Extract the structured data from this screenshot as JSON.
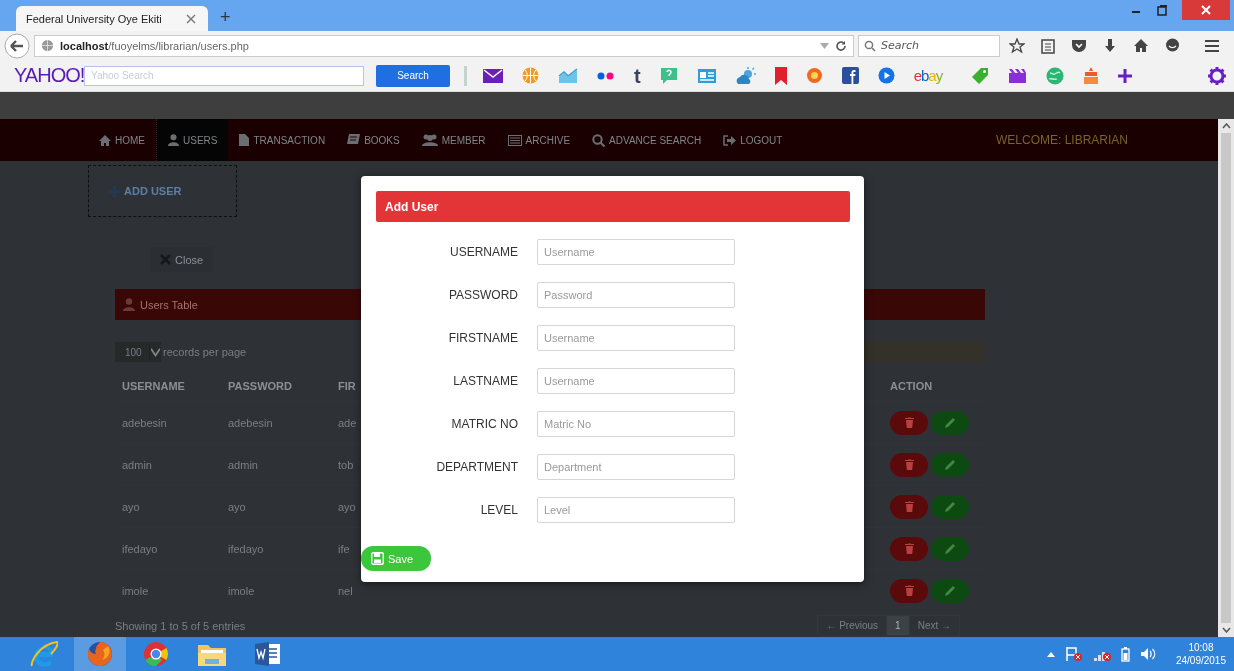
{
  "browser": {
    "tab": {
      "title": "Federal University Oye Ekiti",
      "selected": true
    },
    "new_tab": "+",
    "url": {
      "host": "localhost",
      "path": "/fuoyelms/librarian/users.php"
    },
    "search": {
      "placeholder": "Search"
    }
  },
  "yahoo_toolbar": {
    "logo": "YAHOO!",
    "search": {
      "placeholder": "Yahoo Search"
    },
    "search_button": "Search",
    "tumblr": "t",
    "ebay": "ebay"
  },
  "nav": {
    "items": [
      {
        "kind": "home",
        "label": "HOME",
        "selected": false
      },
      {
        "kind": "user",
        "label": "USERS",
        "selected": true
      },
      {
        "kind": "file",
        "label": "TRANSACTION",
        "selected": false
      },
      {
        "kind": "book",
        "label": "BOOKS",
        "selected": false
      },
      {
        "kind": "group",
        "label": "MEMBER",
        "selected": false
      },
      {
        "kind": "list",
        "label": "ARCHIVE",
        "selected": false
      },
      {
        "kind": "search",
        "label": "ADVANCE SEARCH",
        "selected": false
      },
      {
        "kind": "logout",
        "label": "LOGOUT",
        "selected": false
      }
    ],
    "welcome": "WELCOME: LIBRARIAN"
  },
  "add_user_button": "ADD USER",
  "close_button": "Close",
  "users_table": {
    "title": "Users Table",
    "page_size": "100",
    "page_size_label": "records per page",
    "columns": [
      "USERNAME",
      "PASSWORD",
      "FIR",
      "ACTION"
    ],
    "rows": [
      [
        "adebesin",
        "adebesin",
        "ade"
      ],
      [
        "admin",
        "admin",
        "tob"
      ],
      [
        "ayo",
        "ayo",
        "ayo"
      ],
      [
        "ifedayo",
        "ifedayo",
        "ife"
      ],
      [
        "imole",
        "imole",
        "nel"
      ]
    ],
    "footer": "Showing 1 to 5 of 5 entries",
    "pagination": {
      "previous": "← Previous",
      "pages": [
        {
          "label": "1",
          "selected": true
        }
      ],
      "next": "Next →"
    }
  },
  "modal": {
    "title": "Add User",
    "fields": [
      {
        "label": "USERNAME",
        "placeholder": "Username"
      },
      {
        "label": "PASSWORD",
        "placeholder": "Password"
      },
      {
        "label": "FIRSTNAME",
        "placeholder": "Username"
      },
      {
        "label": "LASTNAME",
        "placeholder": "Username"
      },
      {
        "label": "MATRIC NO",
        "placeholder": "Matric No"
      },
      {
        "label": "DEPARTMENT",
        "placeholder": "Department"
      },
      {
        "label": "LEVEL",
        "placeholder": "Level"
      }
    ],
    "save_button": "Save"
  },
  "taskbar": {
    "apps": [
      {
        "kind": "ie",
        "selected": false
      },
      {
        "kind": "firefox",
        "selected": true
      },
      {
        "kind": "chrome",
        "selected": false
      },
      {
        "kind": "folder",
        "selected": false
      },
      {
        "kind": "word",
        "selected": false
      }
    ],
    "clock": {
      "time": "10:08",
      "date": "24/09/2015"
    }
  }
}
